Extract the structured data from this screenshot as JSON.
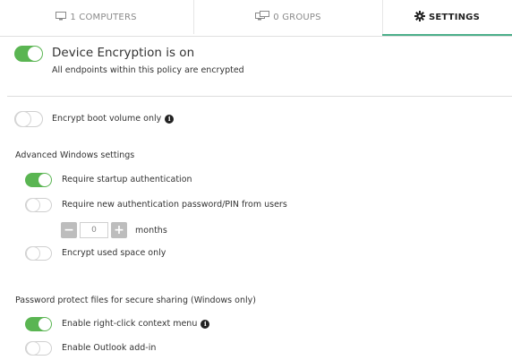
{
  "tabs": [
    {
      "label": "1 COMPUTERS",
      "icon": "computer-icon",
      "active": false
    },
    {
      "label": "0 GROUPS",
      "icon": "groups-icon",
      "active": false
    },
    {
      "label": "SETTINGS",
      "icon": "gear-icon",
      "active": true
    }
  ],
  "hero": {
    "title": "Device Encryption is on",
    "subtitle": "All endpoints within this policy are encrypted",
    "enabled": true
  },
  "boot_volume": {
    "label": "Encrypt boot volume only",
    "enabled": false
  },
  "advanced": {
    "heading": "Advanced Windows settings",
    "startup_auth": {
      "label": "Require startup authentication",
      "enabled": true
    },
    "new_password": {
      "label": "Require new authentication password/PIN from users",
      "enabled": false
    },
    "months_value": "0",
    "months_label": "months",
    "used_space": {
      "label": "Encrypt used space only",
      "enabled": false
    }
  },
  "password_protect": {
    "heading": "Password protect files for secure sharing (Windows only)",
    "context_menu": {
      "label": "Enable right-click context menu",
      "enabled": true
    },
    "outlook": {
      "label": "Enable Outlook add-in",
      "enabled": false
    }
  },
  "colors": {
    "toggle_on": "#5ab552",
    "active_tab_underline": "#4caf8a"
  }
}
